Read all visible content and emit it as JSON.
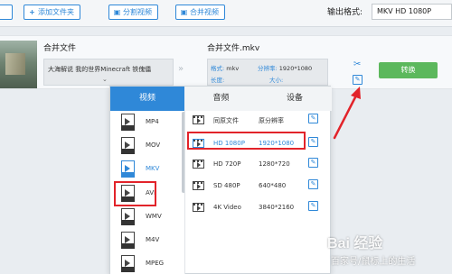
{
  "toolbar": {
    "btn_clipped": "",
    "add_folder": "添加文件夹",
    "split_video": "分割视频",
    "merge_video": "合并视频",
    "output_format_label": "输出格式:",
    "output_format_value": "MKV  HD 1080P"
  },
  "file_row": {
    "source_title": "合并文件",
    "source_name": "大海解说 我的世界Minecraft 铁傀儡",
    "target_title": "合并文件.mkv",
    "format_key": "格式:",
    "format_val": "mkv",
    "resolution_key": "分辨率:",
    "resolution_val": "1920*1080",
    "duration_key": "长度:",
    "size_key": "大小:",
    "convert_label": "转换"
  },
  "panel": {
    "tabs": [
      "视频",
      "音频",
      "设备"
    ],
    "formats": [
      {
        "label": "MP4"
      },
      {
        "label": "MOV"
      },
      {
        "label": "MKV"
      },
      {
        "label": "AVI"
      },
      {
        "label": "WMV"
      },
      {
        "label": "M4V"
      },
      {
        "label": "MPEG"
      }
    ],
    "selected_format": "MKV",
    "qualities": [
      {
        "name": "同原文件",
        "res": "原分辨率"
      },
      {
        "name": "HD 1080P",
        "res": "1920*1080"
      },
      {
        "name": "HD 720P",
        "res": "1280*720"
      },
      {
        "name": "SD 480P",
        "res": "640*480"
      },
      {
        "name": "4K Video",
        "res": "3840*2160"
      }
    ],
    "selected_quality": "HD 1080P"
  },
  "watermark": {
    "brand": "Bai 经验",
    "sub": "百家号/鼠标上的生活"
  },
  "colors": {
    "accent": "#2f88d8",
    "convert_green": "#5cb85c",
    "annotation_red": "#e2232a"
  }
}
